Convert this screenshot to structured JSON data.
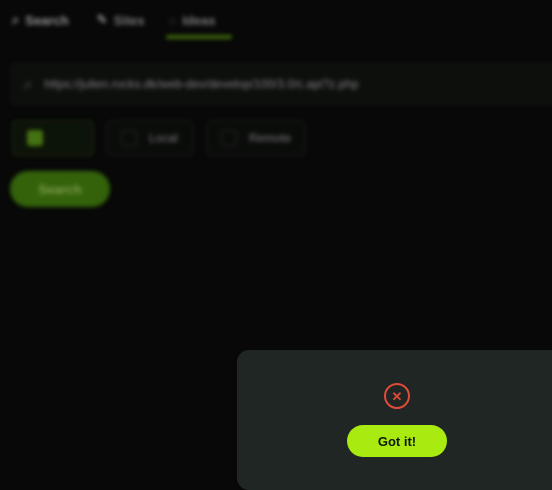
{
  "tabs": [
    {
      "label": "Search",
      "icon": "search-icon"
    },
    {
      "label": "Sites",
      "icon": "pencil-icon"
    },
    {
      "label": "Ideas",
      "icon": "bulb-icon"
    }
  ],
  "url_bar": {
    "value": "https://julien.rocks.dk/web-dev/develop/100/3.0/c.api?z.php",
    "icon": "search-icon"
  },
  "options": [
    "",
    "Local",
    "Remote"
  ],
  "search_button": "Search",
  "error_dialog": {
    "icon": "close-circle-icon",
    "icon_color": "#e04a3a",
    "button_label": "Got it!",
    "button_color": "#a9ea10"
  },
  "colors": {
    "accent": "#a9ea10",
    "background": "#070807",
    "panel": "#202624"
  }
}
